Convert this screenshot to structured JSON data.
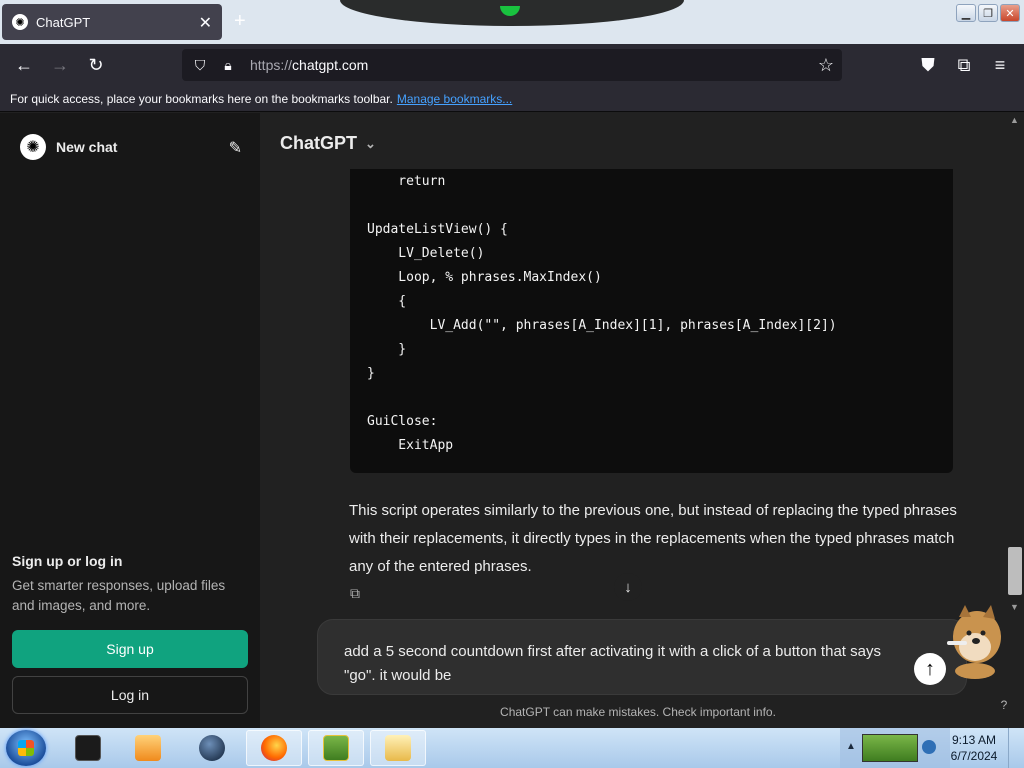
{
  "browser": {
    "tab_title": "ChatGPT",
    "url_scheme": "https://",
    "url_host": "chatgpt.com",
    "bookmarks_message": "For quick access, place your bookmarks here on the bookmarks toolbar.",
    "bookmarks_link": "Manage bookmarks..."
  },
  "sidebar": {
    "new_chat": "New chat",
    "signup_title": "Sign up or log in",
    "signup_desc": "Get smarter responses, upload files and images, and more.",
    "signup_button": "Sign up",
    "login_button": "Log in"
  },
  "main": {
    "model_name": "ChatGPT",
    "code_lines": [
      "    return",
      "",
      "UpdateListView() {",
      "    LV_Delete()",
      "    Loop, % phrases.MaxIndex()",
      "    {",
      "        LV_Add(\"\", phrases[A_Index][1], phrases[A_Index][2])",
      "    }",
      "}",
      "",
      "GuiClose:",
      "    ExitApp"
    ],
    "answer_text": "This script operates similarly to the previous one, but instead of replacing the typed phrases with their replacements, it directly types in the replacements when the typed phrases match any of the entered phrases.",
    "composer_text": "add a 5 second countdown first after activating it with a click of a button that says \"go\". it would be",
    "disclaimer": "ChatGPT can make mistakes. Check important info.",
    "help": "?"
  },
  "taskbar": {
    "time": "9:13 AM",
    "date": "6/7/2024"
  },
  "icons": {
    "tab_favicon": "chatgpt-logo-icon",
    "close_tab": "close-icon",
    "new_tab": "plus-icon",
    "back": "arrow-left-icon",
    "forward": "arrow-right-icon",
    "reload": "reload-icon",
    "shield": "shield-icon",
    "lock": "lock-icon",
    "bookmark": "star-icon",
    "pocket": "pocket-icon",
    "extensions": "puzzle-icon",
    "menu": "hamburger-icon",
    "edit": "edit-icon",
    "copy": "copy-icon",
    "scroll_down": "arrow-down-icon",
    "send": "arrow-up-icon"
  }
}
